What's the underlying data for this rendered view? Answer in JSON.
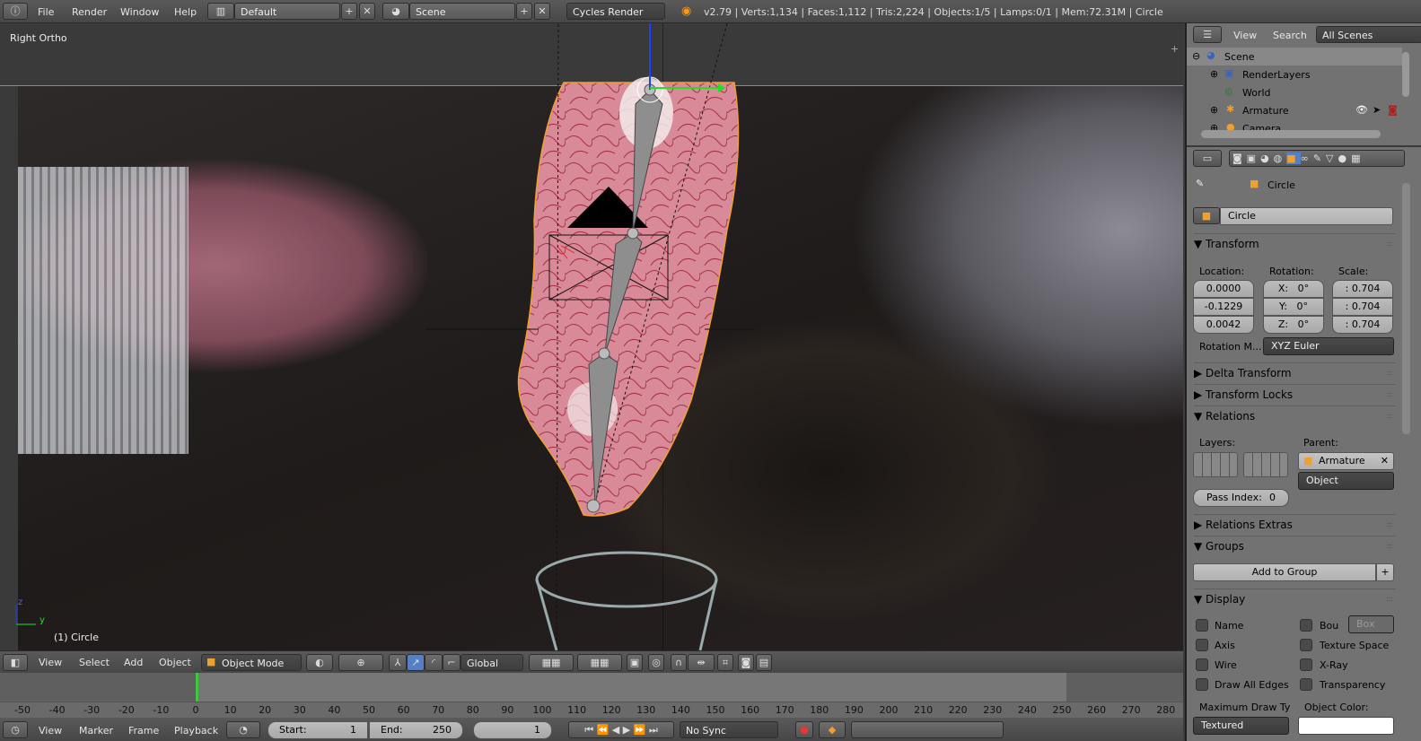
{
  "topbar": {
    "menus": [
      "File",
      "Render",
      "Window",
      "Help"
    ],
    "layout": "Default",
    "scene": "Scene",
    "engine": "Cycles Render",
    "info": "v2.79 | Verts:1,134 | Faces:1,112 | Tris:2,224 | Objects:1/5 | Lamps:0/1 | Mem:72.31M | Circle"
  },
  "viewport": {
    "view_name": "Right Ortho",
    "object_label": "(1) Circle",
    "axis_y": "y",
    "axis_z": "z"
  },
  "view3d_header": {
    "menus": [
      "View",
      "Select",
      "Add",
      "Object"
    ],
    "mode": "Object Mode",
    "orientation": "Global"
  },
  "timeline": {
    "ticks": [
      -50,
      -40,
      -30,
      -20,
      -10,
      0,
      10,
      20,
      30,
      40,
      50,
      60,
      70,
      80,
      90,
      100,
      110,
      120,
      130,
      140,
      150,
      160,
      170,
      180,
      190,
      200,
      210,
      220,
      230,
      240,
      250,
      260,
      270,
      280
    ],
    "current_frame": 0,
    "menus": [
      "View",
      "Marker",
      "Frame",
      "Playback"
    ],
    "start_label": "Start:",
    "start": "1",
    "end_label": "End:",
    "end": "250",
    "frame": "1",
    "sync": "No Sync"
  },
  "outliner": {
    "menus": [
      "View",
      "Search"
    ],
    "filter": "All Scenes",
    "items": [
      "Scene",
      "RenderLayers",
      "World",
      "Armature",
      "Camera"
    ]
  },
  "properties": {
    "breadcrumb": "Circle",
    "object_name": "Circle",
    "transform": {
      "title": "Transform",
      "location_label": "Location:",
      "rotation_label": "Rotation:",
      "scale_label": "Scale:",
      "location": [
        "0.0000",
        "-0.1229",
        "0.0042"
      ],
      "rotation": [
        [
          "X:",
          "0°"
        ],
        [
          "Y:",
          "0°"
        ],
        [
          "Z:",
          "0°"
        ]
      ],
      "scale": [
        ": 0.704",
        ": 0.704",
        ": 0.704"
      ],
      "rotation_mode_label": "Rotation M...",
      "rotation_mode": "XYZ Euler"
    },
    "delta_transform": "Delta Transform",
    "transform_locks": "Transform Locks",
    "relations": {
      "title": "Relations",
      "layers_label": "Layers:",
      "parent_label": "Parent:",
      "parent": "Armature",
      "parent_type": "Object",
      "pass_index_label": "Pass Index:",
      "pass_index": "0"
    },
    "relations_extras": "Relations Extras",
    "groups": {
      "title": "Groups",
      "add_label": "Add to Group"
    },
    "display": {
      "title": "Display",
      "left": [
        "Name",
        "Axis",
        "Wire",
        "Draw All Edges"
      ],
      "right": [
        "Bou",
        "Texture Space",
        "X-Ray",
        "Transparency"
      ],
      "bounds_type": "Box",
      "max_draw_label": "Maximum Draw Ty",
      "max_draw": "Textured",
      "color_label": "Object Color:"
    }
  },
  "colors": {
    "accent": "#5680c2",
    "selected_outline": "#f0a030",
    "current_frame": "#3ec83e"
  }
}
